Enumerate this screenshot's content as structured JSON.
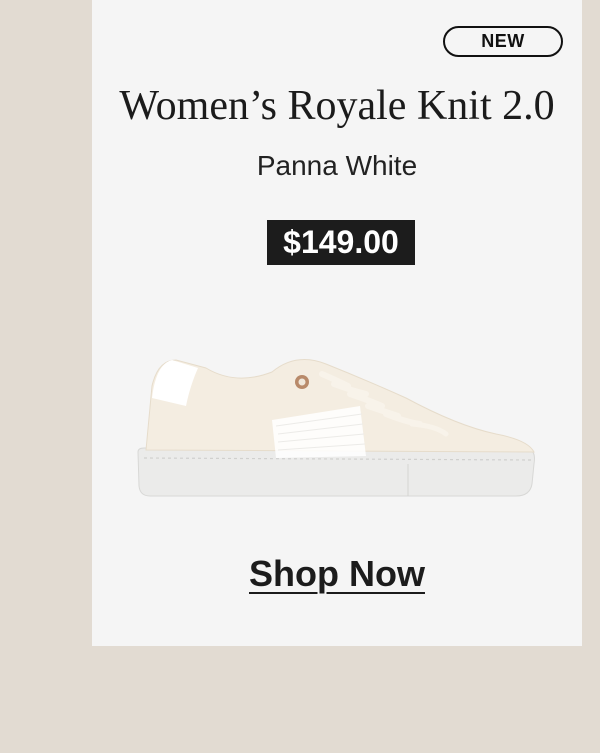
{
  "badge": "NEW",
  "product": {
    "title": "Women’s Royale Knit 2.0",
    "color": "Panna White",
    "price": "$149.00",
    "image_icon": "sneaker-image"
  },
  "cta": {
    "label": "Shop Now"
  },
  "colors": {
    "background": "#e2dbd2",
    "card": "#f5f5f5",
    "price_bg": "#1c1c1c",
    "text": "#1c1c1c"
  }
}
